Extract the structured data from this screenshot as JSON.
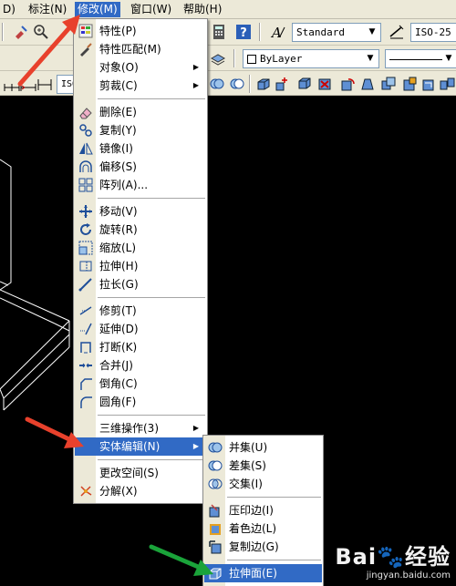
{
  "menubar": {
    "items": [
      "D)",
      "标注(N)",
      "修改(M)",
      "窗口(W)",
      "帮助(H)"
    ]
  },
  "toolbar": {
    "text_style": "Standard",
    "dim_style": "ISO-25",
    "layer_color": "ByLayer",
    "dim_style_small": "ISO"
  },
  "modify_menu": {
    "items": [
      {
        "label": "特性(P)",
        "icon": "properties-icon"
      },
      {
        "label": "特性匹配(M)",
        "icon": "match-properties-icon"
      },
      {
        "label": "对象(O)",
        "submenu": true
      },
      {
        "label": "剪裁(C)",
        "submenu": true
      },
      {
        "label": "删除(E)",
        "icon": "erase-icon"
      },
      {
        "label": "复制(Y)",
        "icon": "copy-icon"
      },
      {
        "label": "镜像(I)",
        "icon": "mirror-icon"
      },
      {
        "label": "偏移(S)",
        "icon": "offset-icon"
      },
      {
        "label": "阵列(A)...",
        "icon": "array-icon"
      },
      {
        "label": "移动(V)",
        "icon": "move-icon"
      },
      {
        "label": "旋转(R)",
        "icon": "rotate-icon"
      },
      {
        "label": "缩放(L)",
        "icon": "scale-icon"
      },
      {
        "label": "拉伸(H)",
        "icon": "stretch-icon"
      },
      {
        "label": "拉长(G)",
        "icon": "lengthen-icon"
      },
      {
        "label": "修剪(T)",
        "icon": "trim-icon"
      },
      {
        "label": "延伸(D)",
        "icon": "extend-icon"
      },
      {
        "label": "打断(K)",
        "icon": "break-icon"
      },
      {
        "label": "合并(J)",
        "icon": "join-icon"
      },
      {
        "label": "倒角(C)",
        "icon": "chamfer-icon"
      },
      {
        "label": "圆角(F)",
        "icon": "fillet-icon"
      },
      {
        "label": "三维操作(3)",
        "submenu": true
      },
      {
        "label": "实体编辑(N)",
        "submenu": true,
        "highlighted": true
      },
      {
        "label": "更改空间(S)"
      },
      {
        "label": "分解(X)",
        "icon": "explode-icon"
      }
    ]
  },
  "solid_edit_menu": {
    "items": [
      {
        "label": "并集(U)",
        "icon": "union-icon"
      },
      {
        "label": "差集(S)",
        "icon": "subtract-icon"
      },
      {
        "label": "交集(I)",
        "icon": "intersect-icon"
      },
      {
        "label": "压印边(I)",
        "icon": "imprint-icon"
      },
      {
        "label": "着色边(L)",
        "icon": "color-edges-icon"
      },
      {
        "label": "复制边(G)",
        "icon": "copy-edges-icon"
      },
      {
        "label": "拉伸面(E)",
        "icon": "extrude-faces-icon",
        "highlighted": true
      }
    ]
  },
  "watermark": {
    "brand": "Bai",
    "brand2": "经验",
    "url": "jingyan.baidu.com"
  },
  "colors": {
    "highlight": "#316ac5",
    "menu_bg": "#ffffff",
    "bar_bg": "#ece9d8",
    "arrow_red": "#e8412c",
    "arrow_green": "#1aa33a"
  }
}
